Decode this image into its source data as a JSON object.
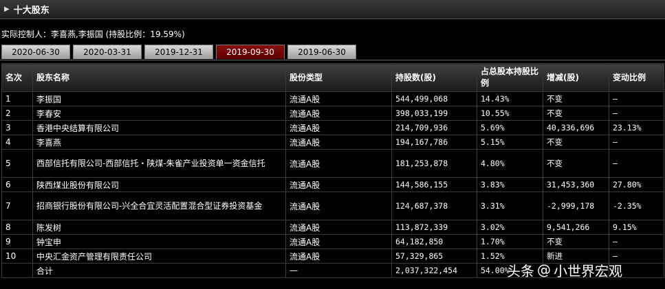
{
  "header": {
    "title": "十大股东"
  },
  "controller": {
    "text": "实际控制人：李喜燕,李振国  (持股比例：19.59%)"
  },
  "tabs": [
    "2020-06-30",
    "2020-03-31",
    "2019-12-31",
    "2019-09-30",
    "2019-06-30"
  ],
  "active_tab": "2019-09-30",
  "table": {
    "headers": [
      "名次",
      "股东名称",
      "股份类型",
      "持股数(股)",
      "占总股本持股比例",
      "增减(股)",
      "变动比例"
    ],
    "rows": [
      [
        "1",
        "李振国",
        "流通A股",
        "544,499,068",
        "14.43%",
        "不变",
        "—"
      ],
      [
        "2",
        "李春安",
        "流通A股",
        "398,033,199",
        "10.55%",
        "不变",
        "—"
      ],
      [
        "3",
        "香港中央结算有限公司",
        "流通A股",
        "214,709,936",
        "5.69%",
        "40,336,696",
        "23.13%"
      ],
      [
        "4",
        "李喜燕",
        "流通A股",
        "194,167,786",
        "5.15%",
        "不变",
        "—"
      ],
      [
        "5",
        "西部信托有限公司-西部信托・陕煤-朱雀产业投资单一资金信托",
        "流通A股",
        "181,253,878",
        "4.80%",
        "不变",
        "—"
      ],
      [
        "6",
        "陕西煤业股份有限公司",
        "流通A股",
        "144,586,155",
        "3.83%",
        "31,453,360",
        "27.80%"
      ],
      [
        "7",
        "招商银行股份有限公司-兴全合宜灵活配置混合型证券投资基金",
        "流通A股",
        "124,687,378",
        "3.31%",
        "-2,999,178",
        "-2.35%"
      ],
      [
        "8",
        "陈发树",
        "流通A股",
        "113,872,339",
        "3.02%",
        "9,541,266",
        "9.15%"
      ],
      [
        "9",
        "钟宝申",
        "流通A股",
        "64,182,850",
        "1.70%",
        "不变",
        "—"
      ],
      [
        "10",
        "中央汇金资产管理有限责任公司",
        "流通A股",
        "57,329,865",
        "1.52%",
        "新进",
        "—"
      ],
      [
        "",
        "合计",
        "—",
        "2,037,322,454",
        "54.00%",
        "",
        ""
      ]
    ]
  },
  "watermark": {
    "brand": "头条",
    "at": "@",
    "author": "小世界宏观"
  }
}
